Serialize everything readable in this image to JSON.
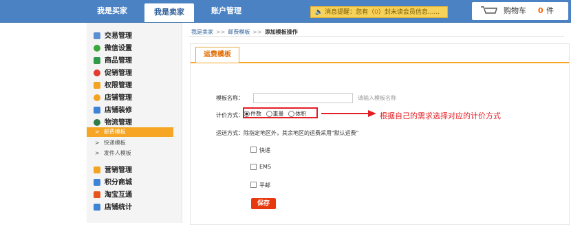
{
  "topbar": {
    "tabs": [
      {
        "label": "我是买家"
      },
      {
        "label": "我是卖家"
      },
      {
        "label": "账户管理"
      }
    ],
    "notice": {
      "prefix": "消息提醒：您有（",
      "count": "0",
      "suffix": "）封未读会员信息......"
    },
    "cart": {
      "label": "购物车",
      "count": "0",
      "unit": "件"
    }
  },
  "sidebar": {
    "groups": [
      {
        "label": "交易管理",
        "icon": "document-icon",
        "color": "#5a8fd0"
      },
      {
        "label": "微信设置",
        "icon": "wechat-icon",
        "color": "#3aa83a"
      },
      {
        "label": "商品管理",
        "icon": "cart-icon",
        "color": "#2e9a4a"
      },
      {
        "label": "促销管理",
        "icon": "target-icon",
        "color": "#e23b2f"
      },
      {
        "label": "权限管理",
        "icon": "key-icon",
        "color": "#f2a31f"
      },
      {
        "label": "店铺管理",
        "icon": "store-icon",
        "color": "#f2a31f"
      },
      {
        "label": "店铺装修",
        "icon": "monitor-icon",
        "color": "#3d83d6"
      },
      {
        "label": "物流管理",
        "icon": "truck-icon",
        "color": "#2e7d46"
      }
    ],
    "logistics_sub": [
      {
        "label": "邮费模板",
        "active": true
      },
      {
        "label": "快递模板",
        "active": false
      },
      {
        "label": "发件人模板",
        "active": false
      }
    ],
    "groups2": [
      {
        "label": "营销管理",
        "icon": "star-icon",
        "color": "#f2a31f"
      },
      {
        "label": "积分商城",
        "icon": "points-icon",
        "color": "#3d83d6"
      },
      {
        "label": "淘宝互通",
        "icon": "taobao-icon",
        "color": "#e8541c"
      },
      {
        "label": "店铺统计",
        "icon": "chart-icon",
        "color": "#3d83d6"
      }
    ]
  },
  "breadcrumb": {
    "items": [
      "我是卖家",
      "邮费模板",
      "添加模板操作"
    ],
    "sep": ">>"
  },
  "form": {
    "tab_label": "运费模板",
    "name_label": "模板名称：",
    "name_value": "",
    "name_hint": "请输入模板名称",
    "pricing_label": "计价方式：",
    "pricing_options": [
      "件数",
      "重量",
      "体积"
    ],
    "pricing_selected": "件数",
    "annotation": "根据自己的需求选择对应的计价方式",
    "shipping_note": "运送方式：除指定地区外，其余地区的运费采用\"默认运费\"",
    "shipping_methods": [
      "快递",
      "EMS",
      "平邮"
    ],
    "save_label": "保存"
  },
  "colors": {
    "topbar": "#4a82c4",
    "accent_orange": "#f6a624",
    "save_red": "#e8380d",
    "annotation_red": "#e31e24"
  }
}
